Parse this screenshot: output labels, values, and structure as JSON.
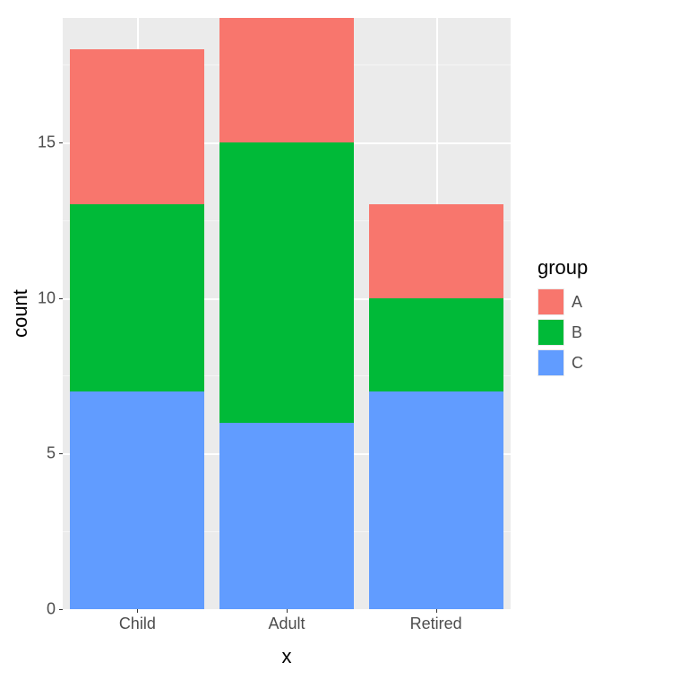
{
  "chart_data": {
    "type": "bar",
    "stacked": true,
    "categories": [
      "Child",
      "Adult",
      "Retired"
    ],
    "series": [
      {
        "name": "A",
        "values": [
          5,
          4,
          3
        ]
      },
      {
        "name": "B",
        "values": [
          6,
          9,
          3
        ]
      },
      {
        "name": "C",
        "values": [
          7,
          6,
          7
        ]
      }
    ],
    "xlabel": "x",
    "ylabel": "count",
    "ylim": [
      0,
      19
    ],
    "y_major_ticks": [
      0,
      5,
      10,
      15
    ],
    "y_minor_ticks": [
      2.5,
      7.5,
      12.5,
      17.5
    ],
    "legend_title": "group",
    "colors": {
      "A": "#f8766d",
      "B": "#00ba38",
      "C": "#619cff"
    }
  }
}
